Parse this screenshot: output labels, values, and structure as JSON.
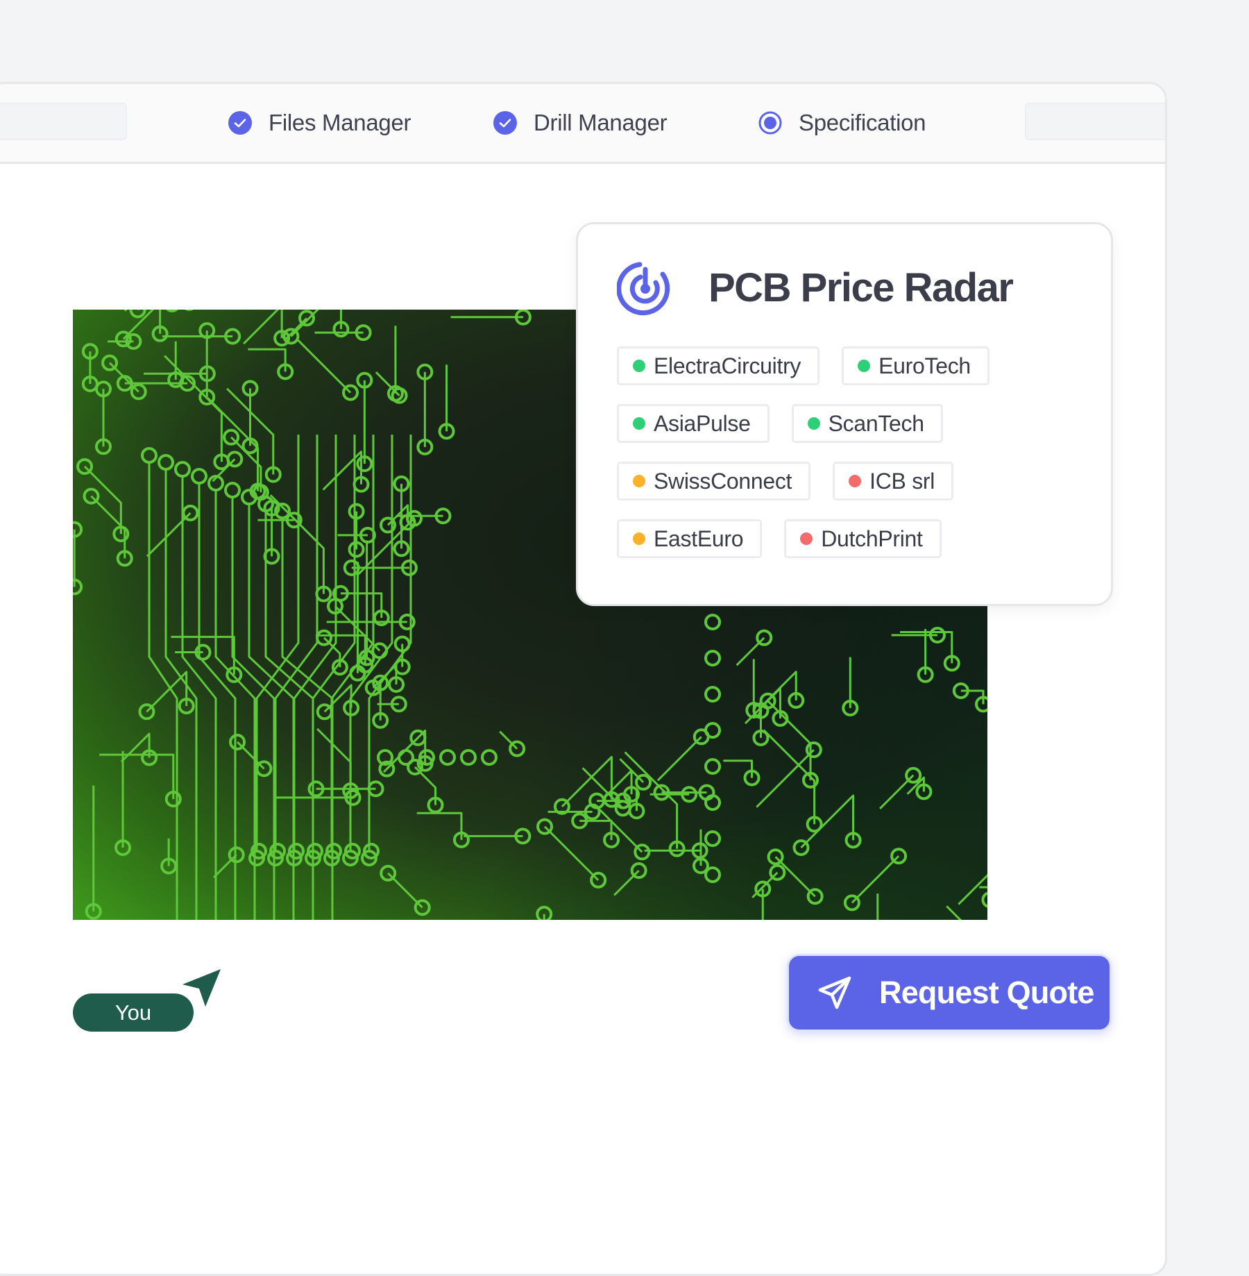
{
  "steps": [
    {
      "label": "Files Manager",
      "state": "completed",
      "icon": "check-circle-icon"
    },
    {
      "label": "Drill Manager",
      "state": "completed",
      "icon": "check-circle-icon"
    },
    {
      "label": "Specification",
      "state": "current",
      "icon": "radio-dot-icon"
    }
  ],
  "radar": {
    "title": "PCB Price Radar",
    "icon": "radar-icon",
    "vendors": [
      {
        "name": "ElectraCircuitry",
        "status": "green"
      },
      {
        "name": "EuroTech",
        "status": "green"
      },
      {
        "name": "AsiaPulse",
        "status": "green"
      },
      {
        "name": "ScanTech",
        "status": "green"
      },
      {
        "name": "SwissConnect",
        "status": "amber"
      },
      {
        "name": "ICB srl",
        "status": "red"
      },
      {
        "name": "EastEuro",
        "status": "amber"
      },
      {
        "name": "DutchPrint",
        "status": "red"
      }
    ]
  },
  "image": {
    "subject": "pcb-circuit-board"
  },
  "actions": {
    "request_quote_label": "Request Quote",
    "icon": "send-icon"
  },
  "cursor": {
    "label": "You",
    "icon": "pointer-arrow-icon"
  },
  "colors": {
    "accent": "#5b64e6",
    "status_green": "#2fcf77",
    "status_amber": "#fbb12a",
    "status_red": "#f36b6b",
    "cursor_badge": "#1f5c4c"
  }
}
